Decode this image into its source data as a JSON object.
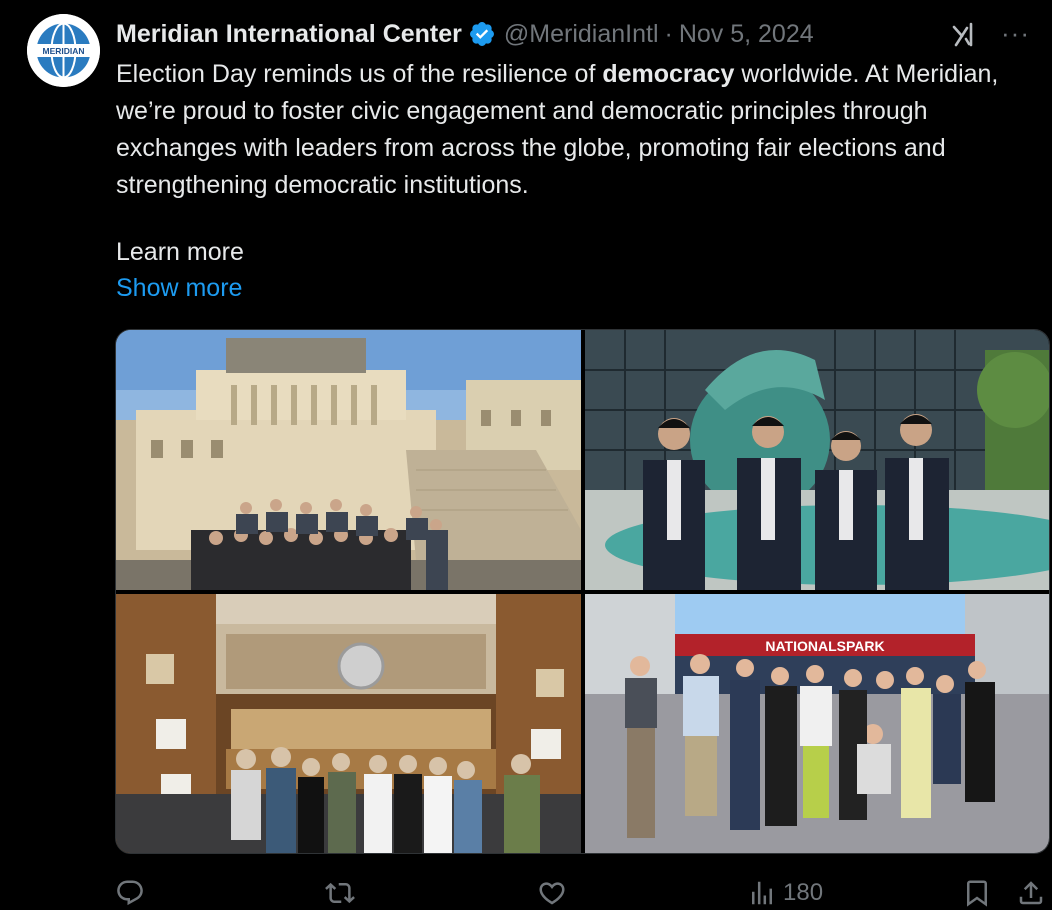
{
  "post": {
    "author_name": "Meridian International Center",
    "handle": "@MeridianIntl",
    "separator": "·",
    "date": "Nov 5, 2024",
    "avatar_text": "MERIDIAN",
    "more_label": "···",
    "text_before_bold": "Election Day reminds us of the resilience of ",
    "text_bold": "democracy",
    "text_after_bold": " worldwide. At Meridian, we’re proud to foster civic engagement and democratic principles through exchanges with leaders from across the globe, promoting fair elections and strengthening democratic institutions.",
    "learn_more": "Learn more",
    "show_more": "Show more"
  },
  "media": {
    "photos": [
      {
        "subject": "group-at-capitol"
      },
      {
        "subject": "four-men-by-fountain-statue"
      },
      {
        "subject": "group-in-council-chamber"
      },
      {
        "subject": "group-at-nationals-park"
      }
    ],
    "sign_text": "NATIONALSPARK"
  },
  "actions": {
    "reply_icon": "reply-icon",
    "repost_icon": "repost-icon",
    "like_icon": "heart-icon",
    "views_icon": "views-icon",
    "views_count": "180",
    "bookmark_icon": "bookmark-icon",
    "share_icon": "share-icon"
  },
  "colors": {
    "background": "#000000",
    "text": "#e7e9ea",
    "muted": "#71767b",
    "link": "#1d9bf0",
    "verified": "#1d9bf0"
  }
}
